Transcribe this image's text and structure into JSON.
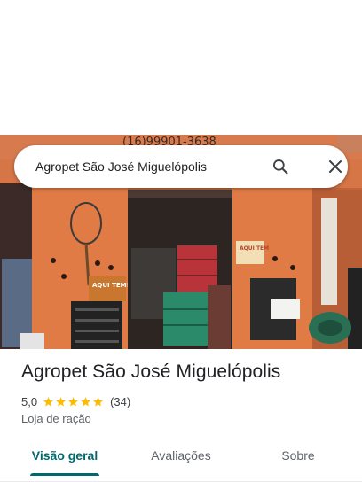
{
  "search": {
    "query": "Agropet São José Miguelópolis",
    "search_icon": "search-icon",
    "close_icon": "close-icon"
  },
  "photo": {
    "phone_sign": "(16)99901-3638",
    "wall_sign": "AQUI TEM!",
    "poster_sign": "AQUI TEM"
  },
  "place": {
    "name": "Agropet São José Miguelópolis",
    "rating": "5,0",
    "stars": 5,
    "review_count": "(34)",
    "category": "Loja de ração"
  },
  "tabs": [
    {
      "label": "Visão geral",
      "active": true
    },
    {
      "label": "Avaliações",
      "active": false
    },
    {
      "label": "Sobre",
      "active": false
    }
  ],
  "colors": {
    "accent": "#00696d",
    "star": "#fbbc04",
    "wall": "#e07b45"
  }
}
